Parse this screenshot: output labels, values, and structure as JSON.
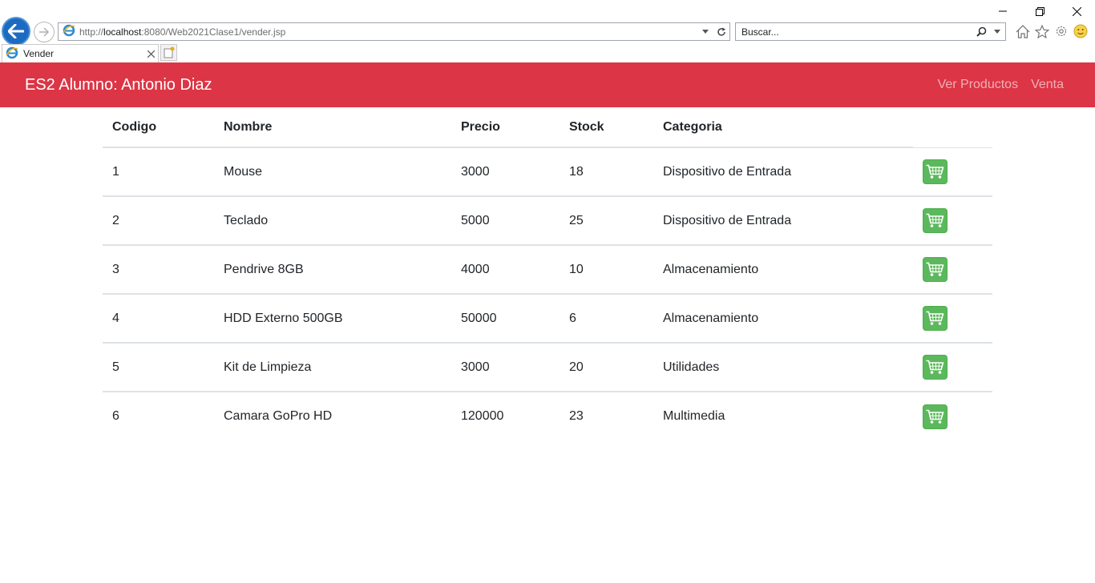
{
  "browser": {
    "url_prefix": "http://",
    "url_host": "localhost",
    "url_rest": ":8080/Web2021Clase1/vender.jsp",
    "search_placeholder": "Buscar...",
    "tab_title": "Vender"
  },
  "navbar": {
    "brand": "ES2 Alumno: Antonio Diaz",
    "links": [
      "Ver Productos",
      "Venta"
    ],
    "bg_color": "#dc3545"
  },
  "table": {
    "headers": [
      "Codigo",
      "Nombre",
      "Precio",
      "Stock",
      "Categoria"
    ],
    "rows": [
      {
        "codigo": "1",
        "nombre": "Mouse",
        "precio": "3000",
        "stock": "18",
        "categoria": "Dispositivo de Entrada"
      },
      {
        "codigo": "2",
        "nombre": "Teclado",
        "precio": "5000",
        "stock": "25",
        "categoria": "Dispositivo de Entrada"
      },
      {
        "codigo": "3",
        "nombre": "Pendrive 8GB",
        "precio": "4000",
        "stock": "10",
        "categoria": "Almacenamiento"
      },
      {
        "codigo": "4",
        "nombre": "HDD Externo 500GB",
        "precio": "50000",
        "stock": "6",
        "categoria": "Almacenamiento"
      },
      {
        "codigo": "5",
        "nombre": "Kit de Limpieza",
        "precio": "3000",
        "stock": "20",
        "categoria": "Utilidades"
      },
      {
        "codigo": "6",
        "nombre": "Camara GoPro HD",
        "precio": "120000",
        "stock": "23",
        "categoria": "Multimedia"
      }
    ],
    "action_icon": "cart-icon",
    "action_color": "#5cb85c"
  }
}
